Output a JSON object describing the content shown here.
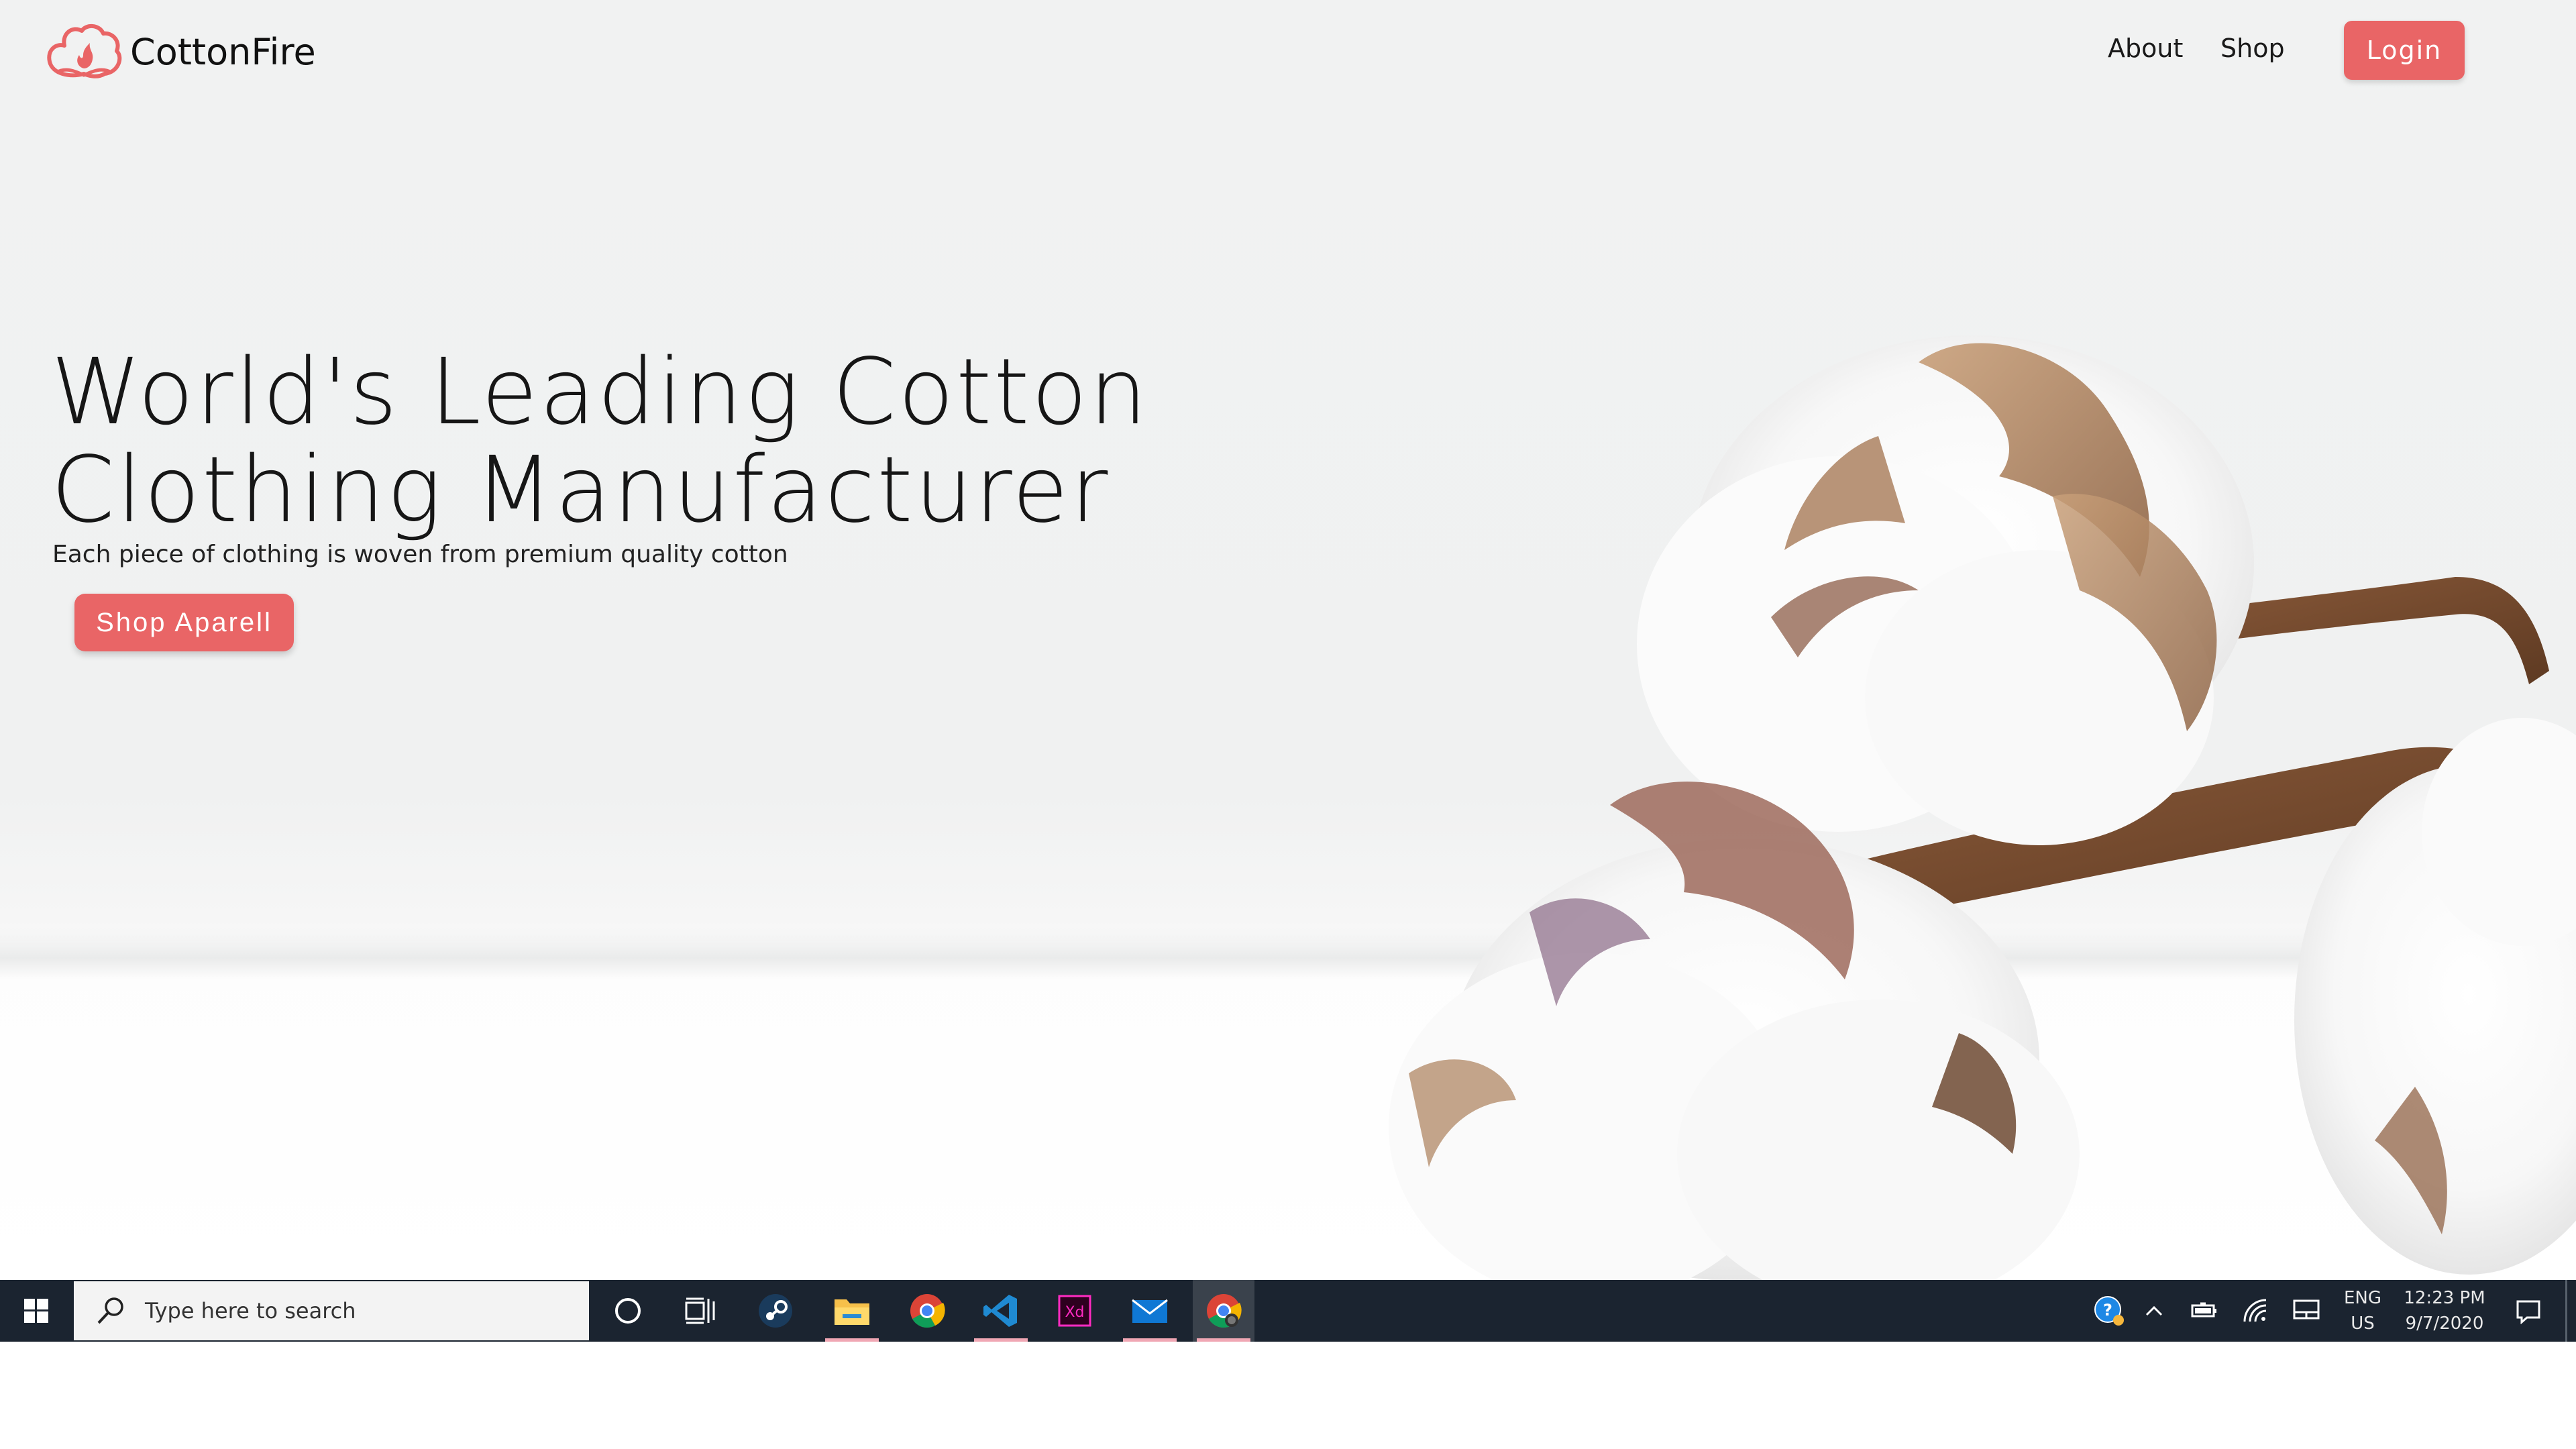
{
  "site": {
    "brand": "CottonFire",
    "nav": {
      "about": "About",
      "shop": "Shop",
      "login": "Login"
    },
    "hero": {
      "title_line1": "World's Leading Cotton",
      "title_line2": "Clothing Manufacturer",
      "subtitle": "Each piece of clothing is woven from premium quality cotton",
      "cta": "Shop Aparell"
    },
    "colors": {
      "accent": "#e96566",
      "text": "#161616",
      "background": "#f1f2f2"
    }
  },
  "taskbar": {
    "search_placeholder": "Type here to search",
    "pinned": [
      "cortana-icon",
      "task-view-icon",
      "steam-icon",
      "file-explorer-icon",
      "chrome-icon",
      "vscode-icon",
      "adobe-xd-icon",
      "mail-icon",
      "chrome-canary-icon"
    ],
    "tray": {
      "language": "ENG",
      "region": "US",
      "time": "12:23 PM",
      "date": "9/7/2020"
    },
    "colors": {
      "background": "#1b2430",
      "running_indicator": "#f0a7b4"
    }
  }
}
